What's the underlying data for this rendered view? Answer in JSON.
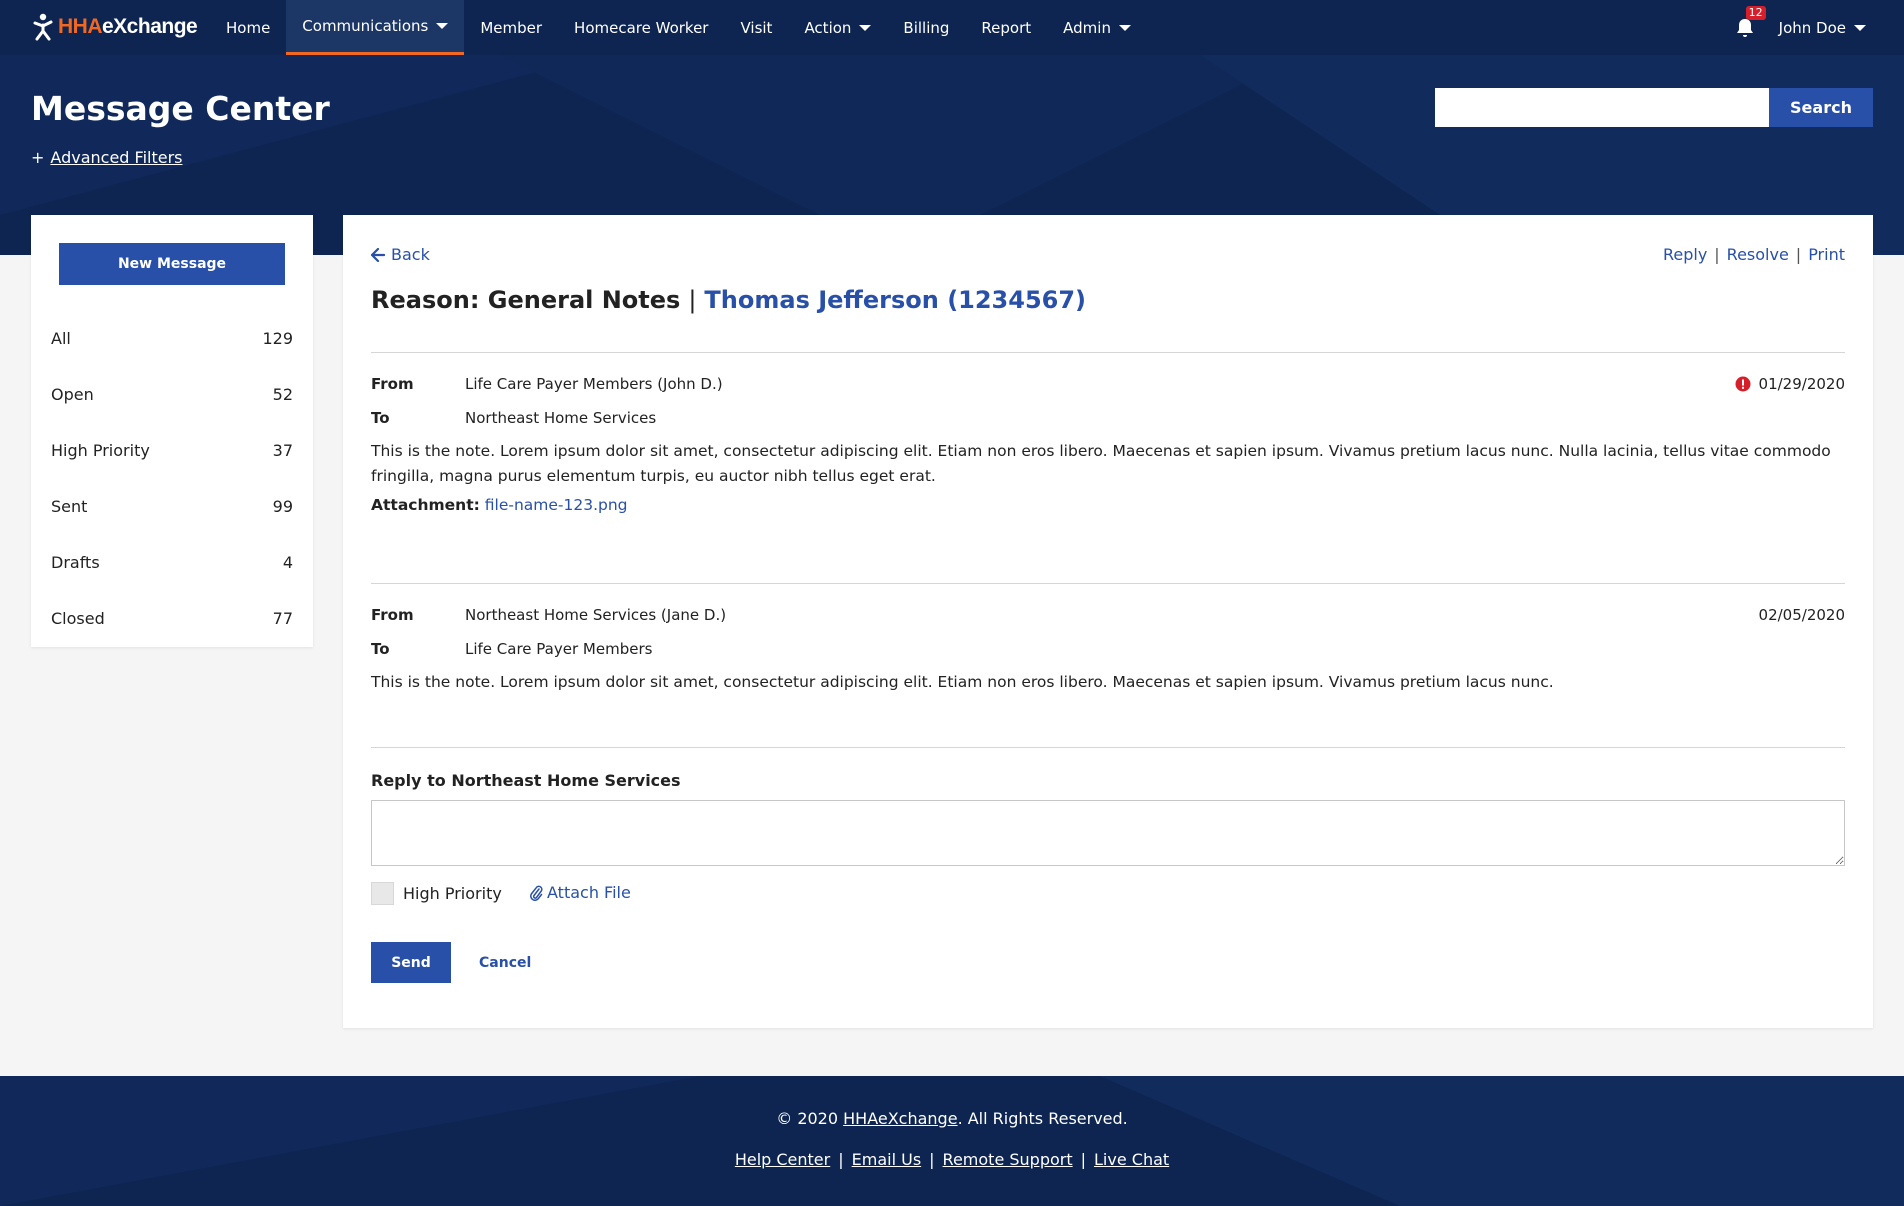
{
  "brand": {
    "part1": "HHA",
    "part2": "eXchange"
  },
  "nav": {
    "items": [
      {
        "label": "Home"
      },
      {
        "label": "Communications"
      },
      {
        "label": "Member"
      },
      {
        "label": "Homecare Worker"
      },
      {
        "label": "Visit"
      },
      {
        "label": "Action"
      },
      {
        "label": "Billing"
      },
      {
        "label": "Report"
      },
      {
        "label": "Admin"
      }
    ],
    "notification_count": "12",
    "user_name": "John Doe"
  },
  "header": {
    "title": "Message Center",
    "plus": "+",
    "advanced_filters": "Advanced Filters",
    "search_value": "",
    "search_label": "Search"
  },
  "sidebar": {
    "new_message": "New Message",
    "folders": [
      {
        "label": "All",
        "count": "129"
      },
      {
        "label": "Open",
        "count": "52"
      },
      {
        "label": "High Priority",
        "count": "37"
      },
      {
        "label": "Sent",
        "count": "99"
      },
      {
        "label": "Drafts",
        "count": "4"
      },
      {
        "label": "Closed",
        "count": "77"
      }
    ]
  },
  "thread": {
    "back": "Back",
    "actions": {
      "reply": "Reply",
      "resolve": "Resolve",
      "print": "Print",
      "separator": "|"
    },
    "reason": "Reason: General Notes",
    "separator": "|",
    "member": "Thomas Jefferson (1234567)",
    "messages": [
      {
        "from_label": "From",
        "from": "Life Care Payer Members (John D.)",
        "to_label": "To",
        "to": "Northeast Home Services",
        "date": "01/29/2020",
        "high_priority": true,
        "body": "This is the note. Lorem ipsum dolor sit amet, consectetur adipiscing elit. Etiam non eros libero. Maecenas et sapien ipsum. Vivamus pretium lacus nunc. Nulla lacinia, tellus vitae commodo fringilla, magna purus elementum turpis, eu auctor nibh tellus eget erat.",
        "attachment_label": "Attachment:",
        "attachment": "file-name-123.png"
      },
      {
        "from_label": "From",
        "from": "Northeast Home Services (Jane D.)",
        "to_label": "To",
        "to": "Life Care Payer Members",
        "date": "02/05/2020",
        "high_priority": false,
        "body": "This is the note. Lorem ipsum dolor sit amet, consectetur adipiscing elit. Etiam non eros libero. Maecenas et sapien ipsum. Vivamus pretium lacus nunc."
      }
    ]
  },
  "reply": {
    "title": "Reply to Northeast Home Services",
    "value": "",
    "high_priority_label": "High Priority",
    "high_priority_checked": false,
    "attach_label": "Attach File",
    "send": "Send",
    "cancel": "Cancel"
  },
  "footer": {
    "copyright_prefix": "© 2020",
    "copyright_link": "HHAeXchange",
    "copyright_suffix": ". All Rights Reserved.",
    "links": [
      "Help Center",
      "Email Us",
      "Remote Support",
      "Live Chat"
    ],
    "separator": "|"
  },
  "colors": {
    "navy": "#0d2550",
    "accent_blue": "#2850a8",
    "brand_orange": "#f26722",
    "alert_red": "#d5202b"
  },
  "icons": [
    "logo-figure-icon",
    "bell-icon",
    "chevron-down-icon",
    "arrow-left-icon",
    "alert-circle-icon",
    "paperclip-icon"
  ]
}
